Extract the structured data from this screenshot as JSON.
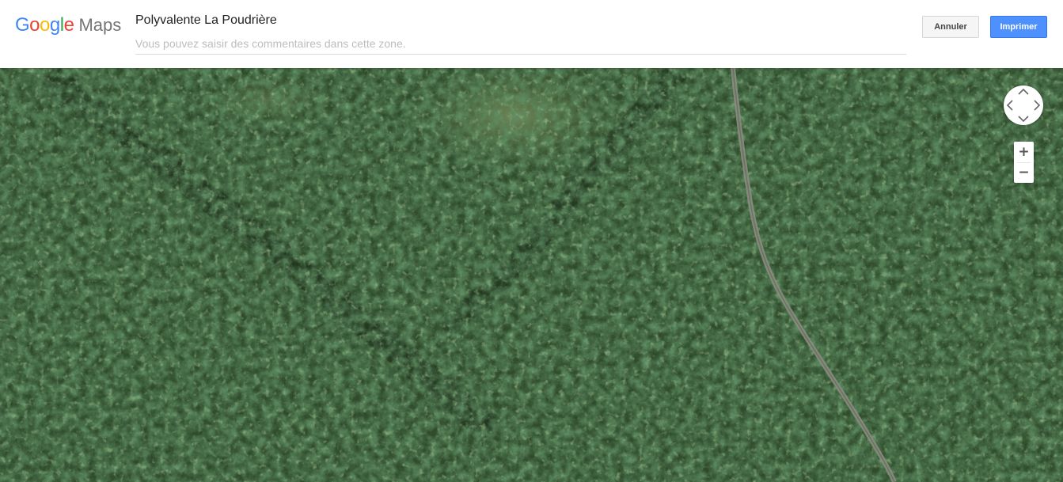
{
  "header": {
    "logo": {
      "google_letters": [
        {
          "char": "G",
          "color": "#4285F4"
        },
        {
          "char": "o",
          "color": "#EA4335"
        },
        {
          "char": "o",
          "color": "#FBBC05"
        },
        {
          "char": "g",
          "color": "#4285F4"
        },
        {
          "char": "l",
          "color": "#34A853"
        },
        {
          "char": "e",
          "color": "#EA4335"
        }
      ],
      "maps_text": "Maps"
    },
    "title": "Polyvalente La Poudrière",
    "comment": {
      "value": "",
      "placeholder": "Vous pouvez saisir des commentaires dans cette zone."
    },
    "cancel_label": "Annuler",
    "print_label": "Imprimer"
  },
  "map": {
    "view": "satellite",
    "icons": {
      "pan": "pan-control-icon",
      "zoom_in": "plus-icon",
      "zoom_out": "minus-icon"
    },
    "zoom_in_label": "+",
    "zoom_out_label": "−"
  },
  "colors": {
    "accent": "#4d90fe",
    "forest": "#2e4a2a",
    "road": "#8a8d80"
  }
}
